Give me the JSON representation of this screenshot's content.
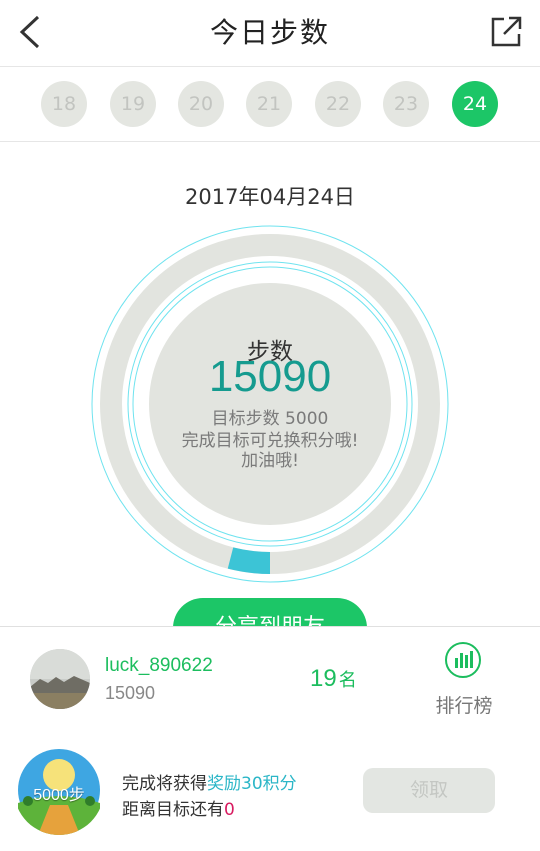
{
  "header": {
    "title": "今日步数"
  },
  "date_selector": {
    "days": [
      "18",
      "19",
      "20",
      "21",
      "22",
      "23",
      "24"
    ],
    "selected": "24"
  },
  "date_text": "2017年04月24日",
  "ring": {
    "label": "步数",
    "steps": "15090",
    "goal_text": "目标步数 5000",
    "message_line1": "完成目标可兑换积分哦!",
    "message_line2": "加油哦!",
    "progress_fraction": 0.04,
    "colors": {
      "track": "#e2e4df",
      "progress": "#3cc4d6",
      "fill": "#e2e4df",
      "outline": "#6fe3ef"
    }
  },
  "share_button": {
    "label": "分享到朋友"
  },
  "rank_panel": {
    "username": "luck_890622",
    "steps": "15090",
    "rank_number": "19",
    "rank_unit": "名",
    "leaderboard_label": "排行榜"
  },
  "reward_panel": {
    "badge_text": "5000步",
    "line1_prefix": "完成将获得",
    "line1_highlight": "奖励30积分",
    "line2_prefix": "距离目标还有",
    "line2_value": "0",
    "claim_label": "领取"
  },
  "colors": {
    "brand_green": "#1cc667",
    "teal_text": "#159b8f",
    "accent_cyan": "#2bb6c7"
  },
  "icons": [
    "back-chevron-icon",
    "share-external-icon",
    "bar-chart-icon"
  ]
}
